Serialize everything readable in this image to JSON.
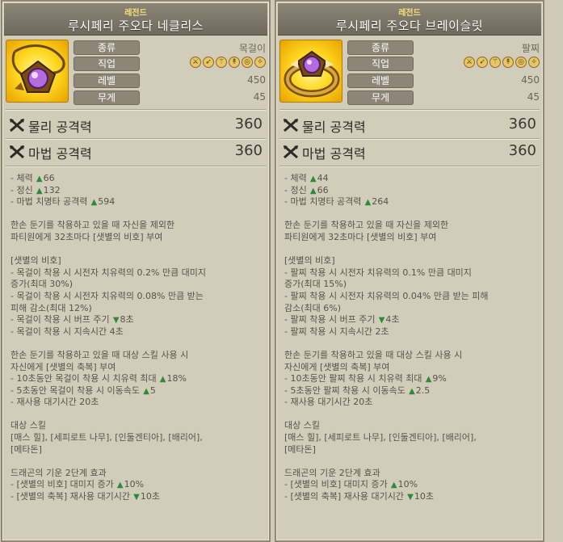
{
  "left": {
    "grade": "레전드",
    "title": "루시페리 주오다 네클리스",
    "stats": [
      {
        "label": "종류",
        "value": "목걸이"
      },
      {
        "label": "직업",
        "value": ""
      },
      {
        "label": "레벨",
        "value": "450"
      },
      {
        "label": "무게",
        "value": "45"
      }
    ],
    "physical_attack_label": "물리 공격력",
    "physical_attack_value": "360",
    "magic_attack_label": "마법 공격력",
    "magic_attack_value": "360",
    "lines": [
      {
        "text": "- 체력",
        "arrow": "up",
        "num": "66"
      },
      {
        "text": "- 정신",
        "arrow": "up",
        "num": "132"
      },
      {
        "text": "- 마법 치명타 공격력",
        "arrow": "up",
        "num": "594"
      },
      {
        "gap": true
      },
      {
        "text": "한손 둔기를 착용하고 있을 때 자신을 제외한"
      },
      {
        "text": "파티원에게 32초마다 [샛별의 비호] 부여"
      },
      {
        "gap": true
      },
      {
        "text": "[샛별의 비호]"
      },
      {
        "text": "- 목걸이 착용 시 시전자 치유력의 0.2% 만큼 대미지"
      },
      {
        "text": "증가(최대 30%)"
      },
      {
        "text": "- 목걸이 착용 시 시전자 치유력의 0.08% 만큼 받는"
      },
      {
        "text": "피해 감소(최대 12%)"
      },
      {
        "text": "- 목걸이 착용 시 버프 주기",
        "arrow": "down",
        "num": "8초"
      },
      {
        "text": "- 목걸이 착용 시 지속시간 4초"
      },
      {
        "gap": true
      },
      {
        "text": "한손 둔기를 착용하고 있을 때 대상 스킬 사용 시"
      },
      {
        "text": "자신에게 [샛별의 축복] 부여"
      },
      {
        "text": "- 10초동안 목걸이 착용 시 치유력 최대",
        "arrow": "up",
        "num": "18%"
      },
      {
        "text": "- 5초동안 목걸이 착용 시 이동속도",
        "arrow": "up",
        "num": "5"
      },
      {
        "text": "- 재사용 대기시간 20초"
      },
      {
        "gap": true
      },
      {
        "text": "대상 스킬"
      },
      {
        "text": "[매스 힐], [세피로트 나무], [인둘겐티아], [배리어],"
      },
      {
        "text": "[메타돈]"
      },
      {
        "gap": true
      },
      {
        "text": "드래곤의 기운 2단계 효과"
      },
      {
        "text": "- [샛별의 비호] 대미지 증가",
        "arrow": "up",
        "num": "10%"
      },
      {
        "text": "- [샛별의 축복] 재사용 대기시간",
        "arrow": "down",
        "num": "10초"
      }
    ]
  },
  "right": {
    "grade": "레전드",
    "title": "루시페리 주오다 브레이슬릿",
    "stats": [
      {
        "label": "종류",
        "value": "팔찌"
      },
      {
        "label": "직업",
        "value": ""
      },
      {
        "label": "레벨",
        "value": "450"
      },
      {
        "label": "무게",
        "value": "45"
      }
    ],
    "physical_attack_label": "물리 공격력",
    "physical_attack_value": "360",
    "magic_attack_label": "마법 공격력",
    "magic_attack_value": "360",
    "lines": [
      {
        "text": "- 체력",
        "arrow": "up",
        "num": "44"
      },
      {
        "text": "- 정신",
        "arrow": "up",
        "num": "66"
      },
      {
        "text": "- 마법 치명타 공격력",
        "arrow": "up",
        "num": "264"
      },
      {
        "gap": true
      },
      {
        "text": "한손 둔기를 착용하고 있을 때 자신을 제외한"
      },
      {
        "text": "파티원에게 32초마다 [샛별의 비호] 부여"
      },
      {
        "gap": true
      },
      {
        "text": "[샛별의 비호]"
      },
      {
        "text": "- 팔찌 착용 시 시전자 치유력의 0.1% 만큼 대미지"
      },
      {
        "text": "증가(최대 15%)"
      },
      {
        "text": "- 팔찌 착용 시 시전자 치유력의 0.04% 만큼 받는 피해"
      },
      {
        "text": "감소(최대 6%)"
      },
      {
        "text": "- 팔찌 착용 시 버프 주기",
        "arrow": "down",
        "num": "4초"
      },
      {
        "text": "- 팔찌 착용 시 지속시간 2초"
      },
      {
        "gap": true
      },
      {
        "text": "한손 둔기를 착용하고 있을 때 대상 스킬 사용 시"
      },
      {
        "text": "자신에게 [샛별의 축복] 부여"
      },
      {
        "text": "- 10초동안 팔찌 착용 시 치유력 최대",
        "arrow": "up",
        "num": "9%"
      },
      {
        "text": "- 5초동안 팔찌 착용 시 이동속도",
        "arrow": "up",
        "num": "2.5"
      },
      {
        "text": "- 재사용 대기시간 20초"
      },
      {
        "gap": true
      },
      {
        "text": "대상 스킬"
      },
      {
        "text": "[매스 힐], [세피로트 나무], [인둘겐티아], [배리어],"
      },
      {
        "text": "[메타돈]"
      },
      {
        "gap": true
      },
      {
        "text": "드래곤의 기운 2단계 효과"
      },
      {
        "text": "- [샛별의 비호] 대미지 증가",
        "arrow": "up",
        "num": "10%"
      },
      {
        "text": "- [샛별의 축복] 재사용 대기시간",
        "arrow": "down",
        "num": "10초"
      }
    ]
  }
}
